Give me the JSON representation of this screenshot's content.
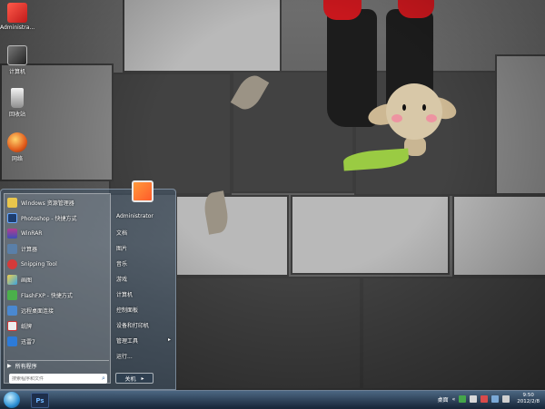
{
  "desktop_icons": [
    {
      "label": "Administra..."
    },
    {
      "label": "计算机"
    },
    {
      "label": "回收站"
    },
    {
      "label": "网络"
    }
  ],
  "start_menu": {
    "programs": [
      {
        "label": "Windows 资源管理器"
      },
      {
        "label": "Photoshop - 快捷方式"
      },
      {
        "label": "WinRAR"
      },
      {
        "label": "计算器"
      },
      {
        "label": "Snipping Tool"
      },
      {
        "label": "画图"
      },
      {
        "label": "FlashFXP - 快捷方式"
      },
      {
        "label": "远程桌面连接"
      },
      {
        "label": "纸牌"
      },
      {
        "label": "迅雷7"
      }
    ],
    "all_programs_label": "所有程序",
    "search_placeholder": "搜索程序和文件",
    "right_items": [
      {
        "label": "Administrator"
      },
      {
        "label": "文档"
      },
      {
        "label": "图片"
      },
      {
        "label": "音乐"
      },
      {
        "label": "游戏"
      },
      {
        "label": "计算机"
      },
      {
        "label": "控制面板"
      },
      {
        "label": "设备和打印机"
      },
      {
        "label": "管理工具"
      },
      {
        "label": "运行..."
      }
    ],
    "shutdown_label": "关机"
  },
  "taskbar": {
    "pinned_app": "Ps",
    "tray_desktop_label": "桌面",
    "clock_time": "9:50",
    "clock_date": "2012/2/8"
  },
  "icons": [
    "windows-start-orb-icon",
    "photoshop-icon",
    "computer-icon",
    "recycle-bin-icon",
    "network-icon",
    "user-icon"
  ]
}
